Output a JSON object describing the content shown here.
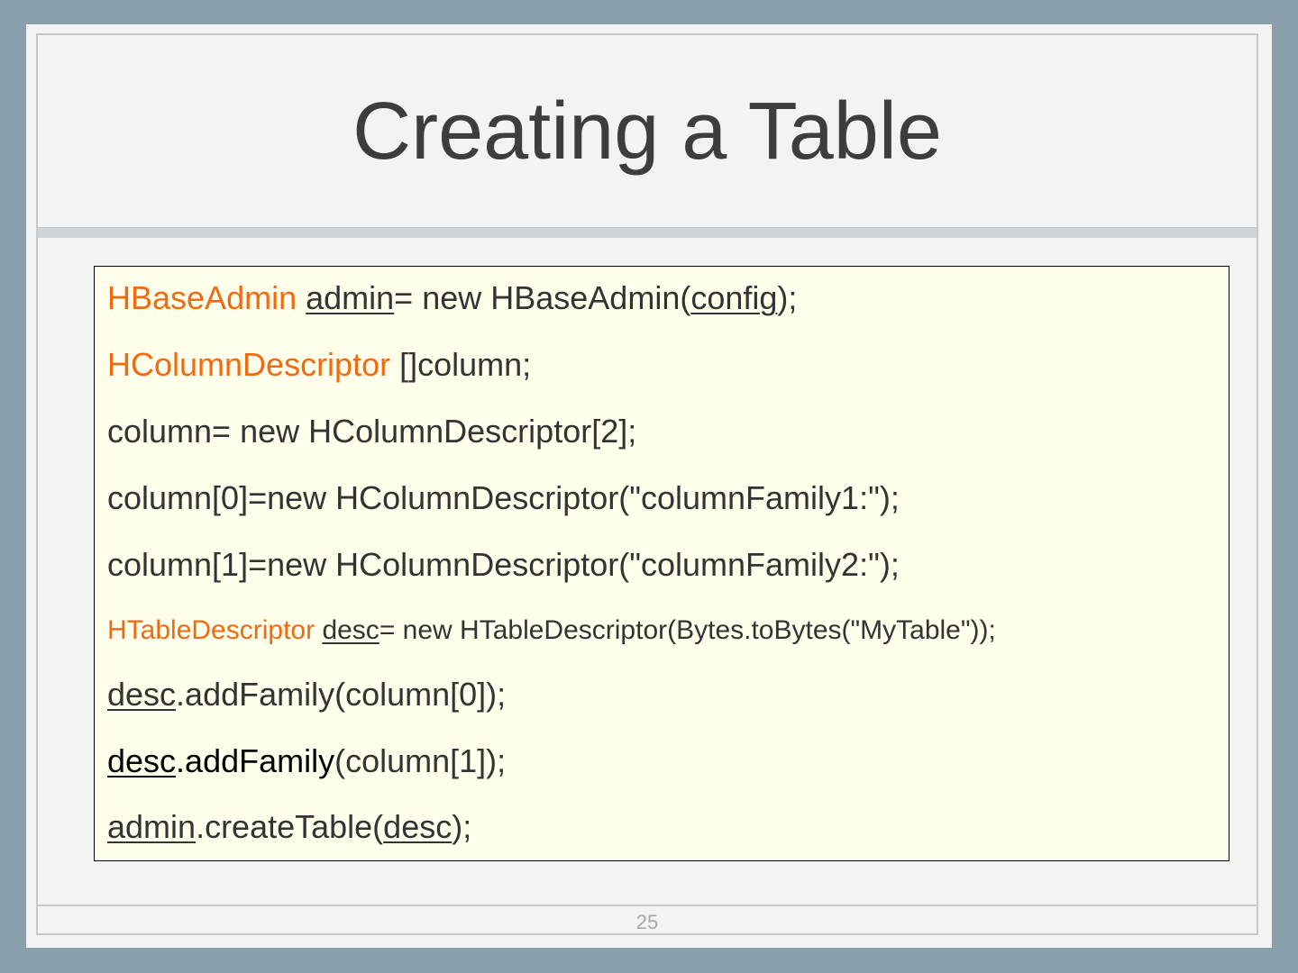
{
  "slide": {
    "title": "Creating a Table",
    "page_number": "25",
    "colors": {
      "keyword": "#f26a10",
      "text": "#333333",
      "background": "#ffffec"
    },
    "code_lines": [
      {
        "size": "normal",
        "segments": [
          {
            "text": "HBaseAdmin",
            "style": "kw"
          },
          {
            "text": " ",
            "style": ""
          },
          {
            "text": "admin",
            "style": "u"
          },
          {
            "text": "= new HBaseAdmin(",
            "style": ""
          },
          {
            "text": "config",
            "style": "u"
          },
          {
            "text": ");",
            "style": ""
          }
        ]
      },
      {
        "size": "normal",
        "segments": [
          {
            "text": "HColumnDescriptor",
            "style": "kw"
          },
          {
            "text": " []column;",
            "style": ""
          }
        ]
      },
      {
        "size": "normal",
        "segments": [
          {
            "text": "column= new HColumnDescriptor[2];",
            "style": ""
          }
        ]
      },
      {
        "size": "normal",
        "segments": [
          {
            "text": "column[0]=new HColumnDescriptor(\"columnFamily1:\");",
            "style": ""
          }
        ]
      },
      {
        "size": "normal",
        "segments": [
          {
            "text": "column[1]=new HColumnDescriptor(\"columnFamily2:\");",
            "style": ""
          }
        ]
      },
      {
        "size": "small",
        "segments": [
          {
            "text": "HTableDescriptor",
            "style": "kw"
          },
          {
            "text": " ",
            "style": ""
          },
          {
            "text": "desc",
            "style": "u"
          },
          {
            "text": "= new HTableDescriptor(Bytes.toBytes(\"MyTable\"));",
            "style": ""
          }
        ]
      },
      {
        "size": "normal",
        "segments": [
          {
            "text": "desc",
            "style": "u"
          },
          {
            "text": ".addFamily(column[0]);",
            "style": ""
          }
        ]
      },
      {
        "size": "normal",
        "segments": [
          {
            "text": "desc",
            "style": "u dark"
          },
          {
            "text": ".addFamily",
            "style": "dark"
          },
          {
            "text": "(column[1]);",
            "style": ""
          }
        ]
      },
      {
        "size": "normal",
        "segments": [
          {
            "text": "admin",
            "style": "u"
          },
          {
            "text": ".createTable(",
            "style": ""
          },
          {
            "text": "desc",
            "style": "u"
          },
          {
            "text": ");",
            "style": ""
          }
        ]
      }
    ]
  }
}
